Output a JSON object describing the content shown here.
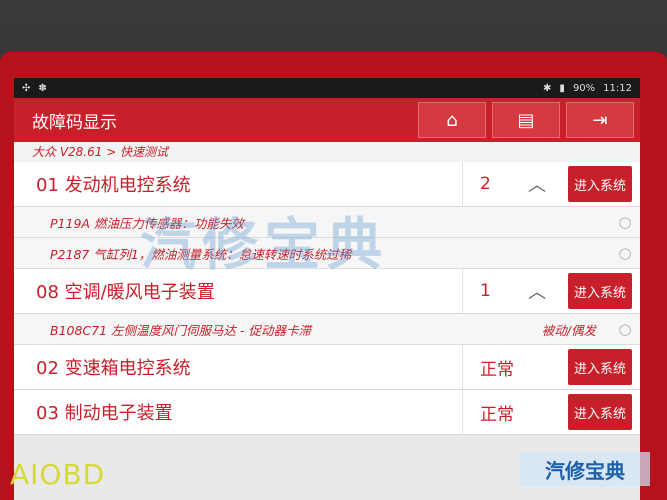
{
  "status": {
    "left_icons": [
      "✣",
      "✽"
    ],
    "battery": "90%",
    "time": "11:12"
  },
  "header": {
    "title": "故障码显示"
  },
  "breadcrumb": "大众 V28.61 > 快速测试",
  "systems": [
    {
      "name": "01 发动机电控系统",
      "count": "2",
      "button": "进入系统",
      "dtcs": [
        {
          "text": "P119A 燃油压力传感器：功能失效",
          "status": ""
        },
        {
          "text": "P2187 气缸列1，燃油测量系统：怠速转速时系统过稀",
          "status": ""
        }
      ]
    },
    {
      "name": "08 空调/暖风电子装置",
      "count": "1",
      "button": "进入系统",
      "dtcs": [
        {
          "text": "B108C71 左侧温度风门伺服马达 - 促动器卡滞",
          "status": "被动/偶发"
        }
      ]
    },
    {
      "name": "02 变速箱电控系统",
      "ok": "正常",
      "button": "进入系统"
    },
    {
      "name": "03 制动电子装置",
      "ok": "正常",
      "button": "进入系统"
    }
  ],
  "watermark": "汽修宝典",
  "logo": "AIOBD",
  "logo2": "汽修宝典"
}
